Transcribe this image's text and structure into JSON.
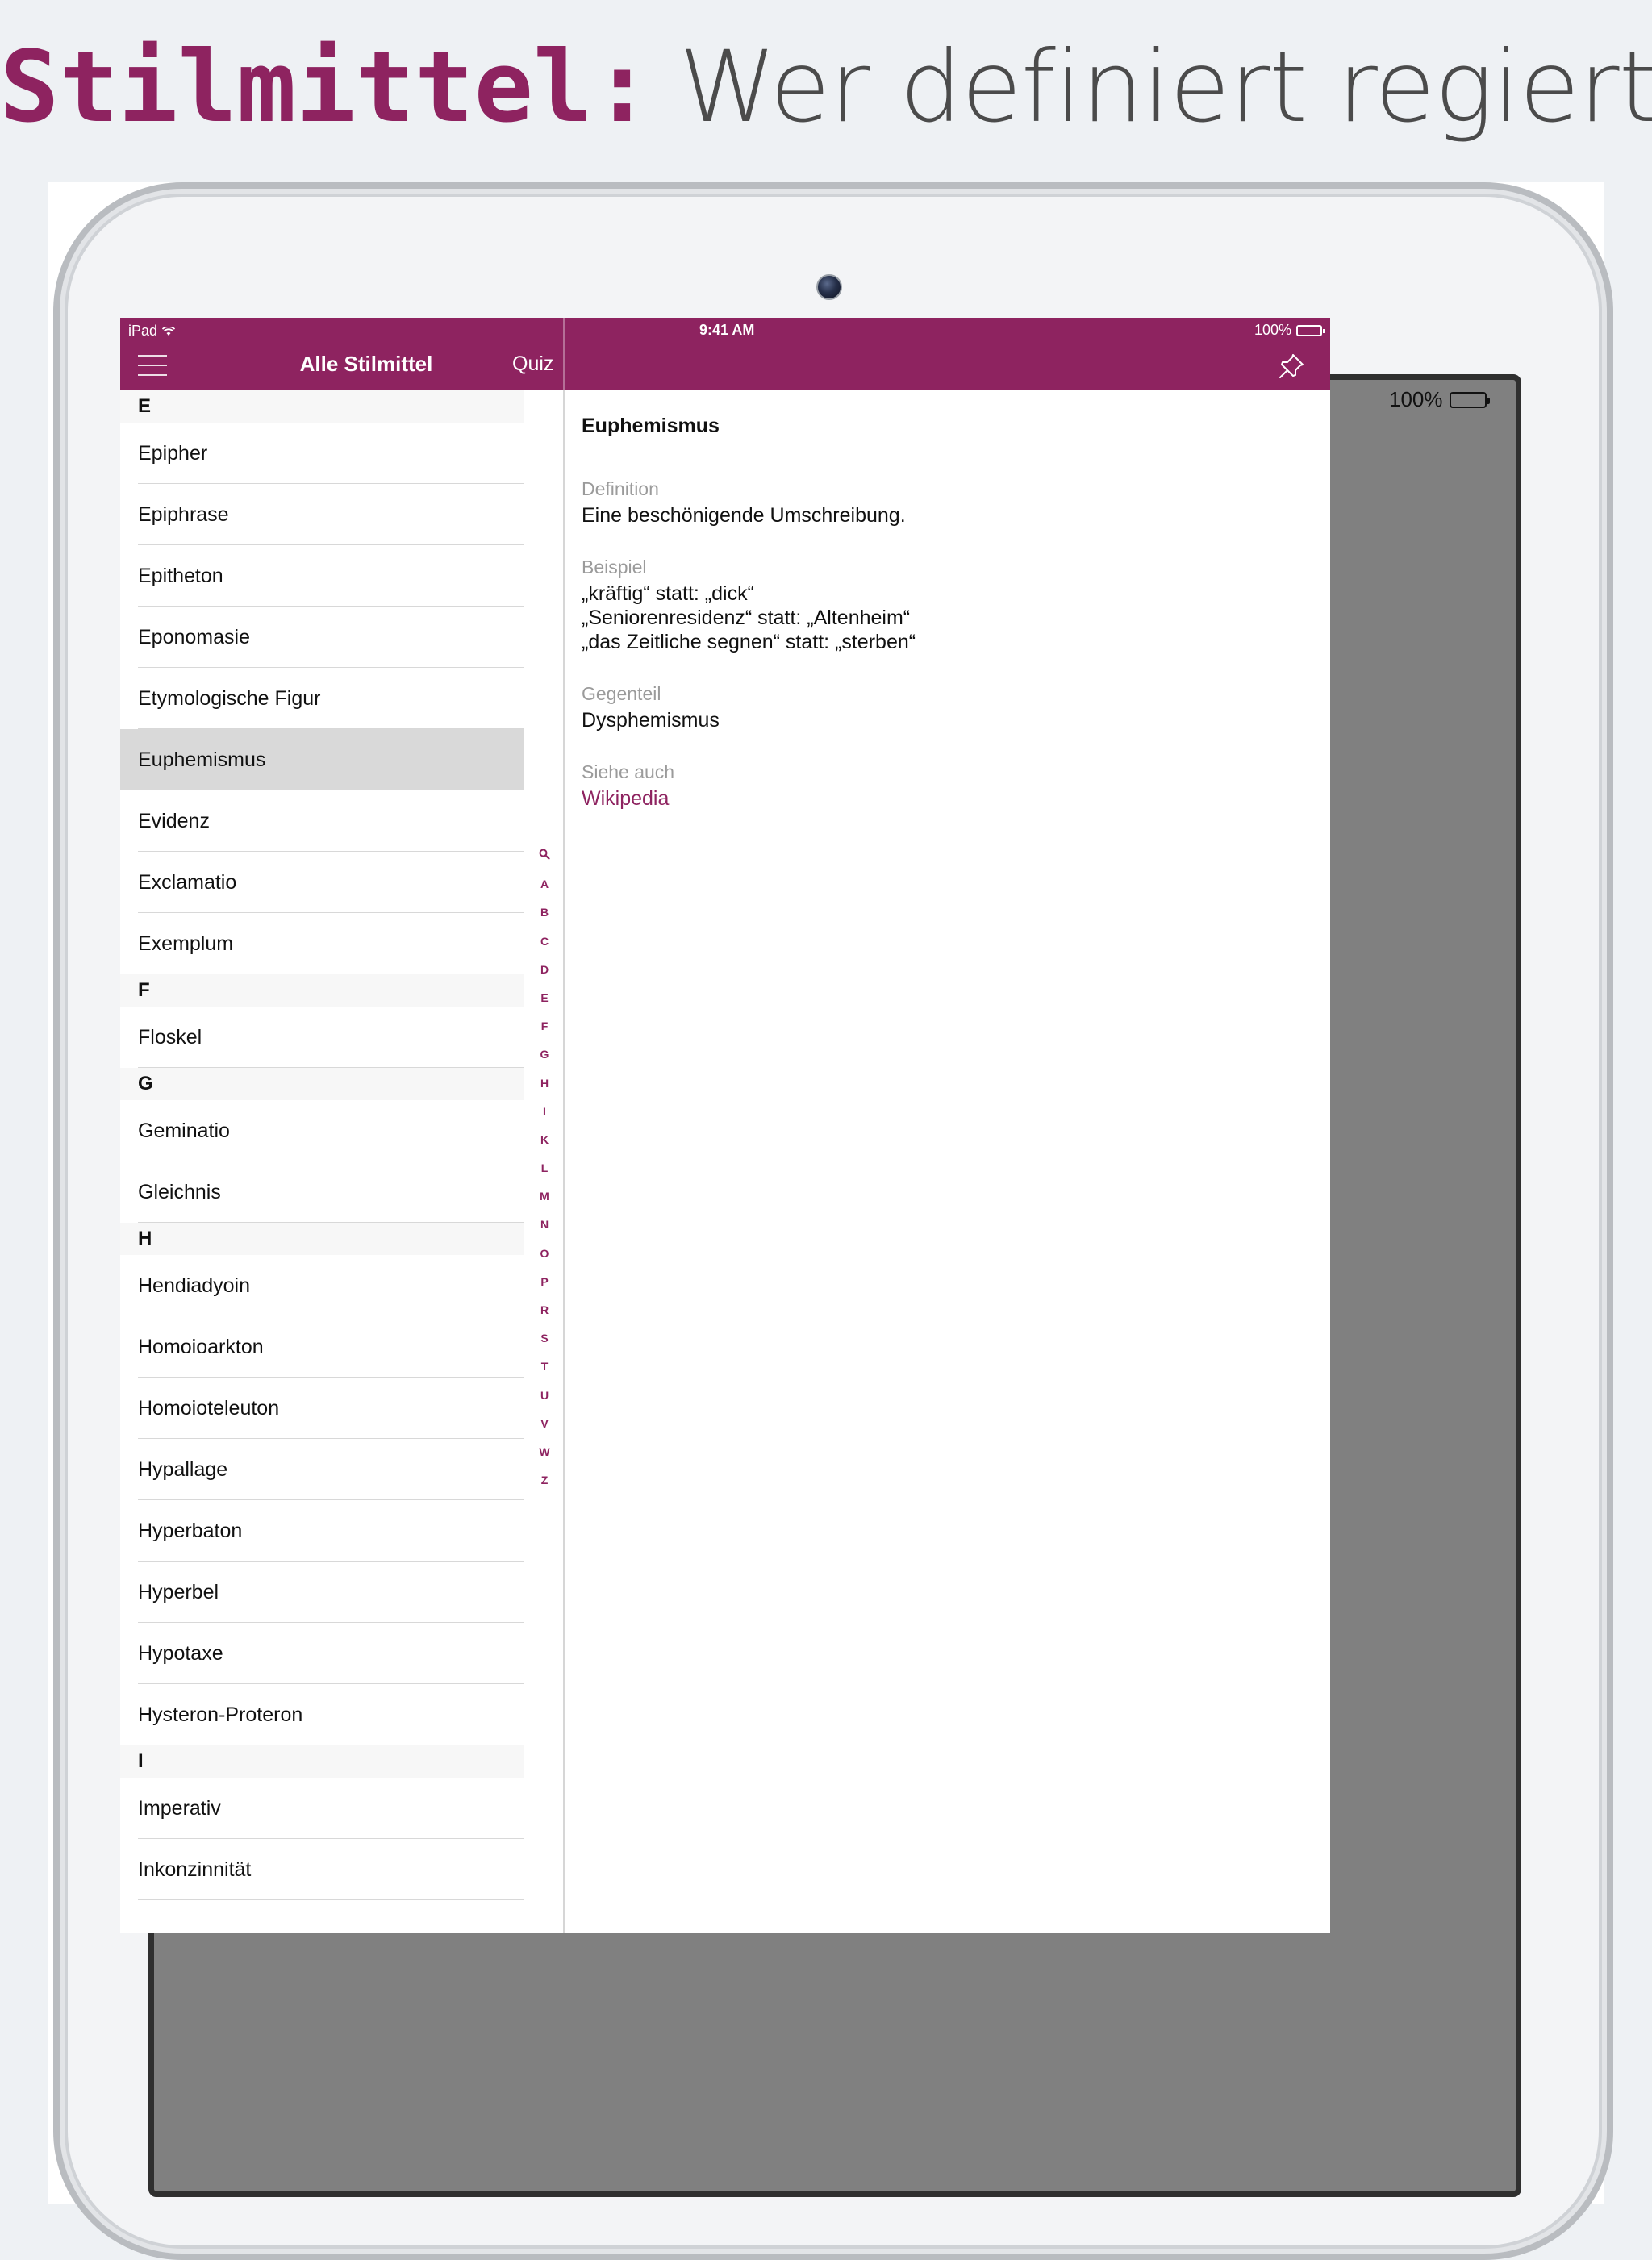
{
  "headline": {
    "brand": "Stilmittel:",
    "tagline": "Wer definiert regiert."
  },
  "background_device": {
    "battery": "100%"
  },
  "status_bar": {
    "carrier": "iPad",
    "time": "9:41 AM",
    "battery": "100%"
  },
  "nav": {
    "title": "Alle Stilmittel",
    "quiz_label": "Quiz"
  },
  "list": [
    {
      "header": "E",
      "items": [
        "Epipher",
        "Epiphrase",
        "Epitheton",
        "Eponomasie",
        "Etymologische Figur",
        "Euphemismus",
        "Evidenz",
        "Exclamatio",
        "Exemplum"
      ]
    },
    {
      "header": "F",
      "items": [
        "Floskel"
      ]
    },
    {
      "header": "G",
      "items": [
        "Geminatio",
        "Gleichnis"
      ]
    },
    {
      "header": "H",
      "items": [
        "Hendiadyoin",
        "Homoioarkton",
        "Homoioteleuton",
        "Hypallage",
        "Hyperbaton",
        "Hyperbel",
        "Hypotaxe",
        "Hysteron-Proteron"
      ]
    },
    {
      "header": "I",
      "items": [
        "Imperativ",
        "Inkonzinnität"
      ]
    }
  ],
  "selected_item": "Euphemismus",
  "index_letters": [
    "A",
    "B",
    "C",
    "D",
    "E",
    "F",
    "G",
    "H",
    "I",
    "K",
    "L",
    "M",
    "N",
    "O",
    "P",
    "R",
    "S",
    "T",
    "U",
    "V",
    "W",
    "Z"
  ],
  "detail": {
    "title": "Euphemismus",
    "definition_label": "Definition",
    "definition": "Eine beschönigende Umschreibung.",
    "example_label": "Beispiel",
    "examples": [
      "„kräftig“ statt: „dick“",
      "„Seniorenresidenz“ statt: „Altenheim“",
      "„das Zeitliche segnen“ statt: „sterben“"
    ],
    "opposite_label": "Gegenteil",
    "opposite": "Dysphemismus",
    "see_also_label": "Siehe auch",
    "see_also_link": "Wikipedia"
  },
  "colors": {
    "accent": "#8e2360",
    "back_screen": "#808080",
    "page_background": "#eef1f4"
  },
  "icons": {
    "menu": "hamburger-icon",
    "pin": "pin-icon",
    "search": "search-icon",
    "wifi": "wifi-icon",
    "battery": "battery-icon"
  }
}
